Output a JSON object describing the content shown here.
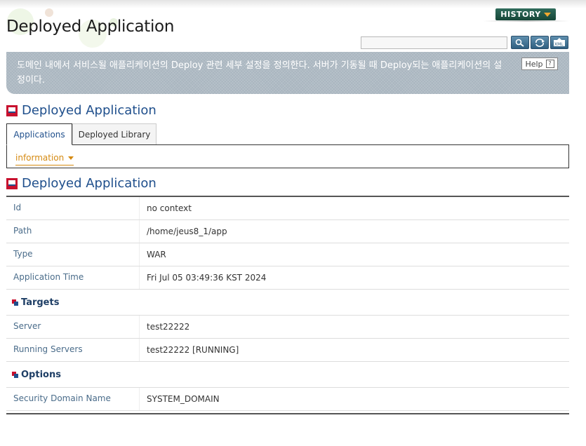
{
  "header": {
    "title": "Deployed Application",
    "history_label": "HISTORY",
    "search_placeholder": ""
  },
  "description": {
    "text": "도메인 내에서 서비스될 애플리케이션의 Deploy 관련 세부 설정을 정의한다. 서버가 기동될 때 Deploy되는 애플리케이션의 설정이다.",
    "help_label": "Help"
  },
  "section1": {
    "title": "Deployed Application"
  },
  "tabs": [
    {
      "label": "Applications",
      "active": true
    },
    {
      "label": "Deployed Library",
      "active": false
    }
  ],
  "subnav": {
    "label": "information"
  },
  "section2": {
    "title": "Deployed Application"
  },
  "details": [
    {
      "label": "Id",
      "value": "no context"
    },
    {
      "label": "Path",
      "value": "/home/jeus8_1/app"
    },
    {
      "label": "Type",
      "value": "WAR"
    },
    {
      "label": "Application Time",
      "value": "Fri Jul 05 03:49:36 KST 2024"
    }
  ],
  "targets": {
    "title": "Targets",
    "rows": [
      {
        "label": "Server",
        "value": "test22222"
      },
      {
        "label": "Running Servers",
        "value": "test22222 [RUNNING]"
      }
    ]
  },
  "options": {
    "title": "Options",
    "rows": [
      {
        "label": "Security Domain Name",
        "value": "SYSTEM_DOMAIN"
      }
    ]
  },
  "icons": [
    "search-icon",
    "refresh-icon",
    "xml-export-icon",
    "help-icon",
    "section-icon",
    "chevron-down-icon"
  ],
  "colors": {
    "accent": "#1f4f8c",
    "history": "#164638",
    "link": "#d58a12",
    "banner": "#a9b5bf"
  }
}
